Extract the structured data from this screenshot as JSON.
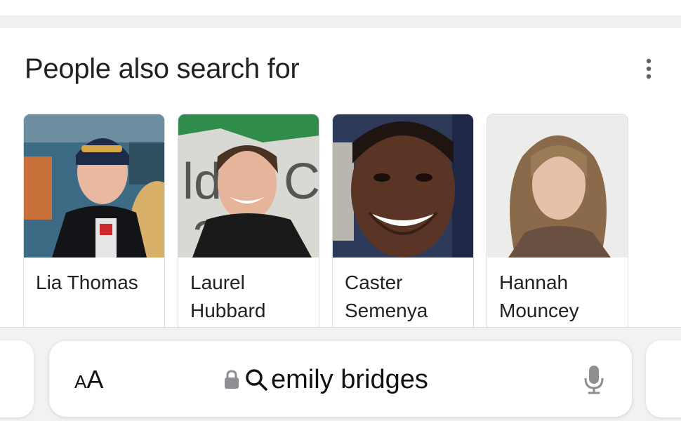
{
  "section": {
    "title": "People also search for",
    "more_icon": "vertical-dots-icon"
  },
  "people": [
    {
      "name": "Lia Thomas",
      "photo": "swimmer-portrait"
    },
    {
      "name": "Laurel Hubbard",
      "photo": "weightlifter-portrait"
    },
    {
      "name": "Caster Semenya",
      "photo": "runner-portrait"
    },
    {
      "name": "Hannah Mouncey",
      "photo": "athlete-portrait"
    }
  ],
  "address_bar": {
    "text_size_label_small": "A",
    "text_size_label_large": "A",
    "query": "emily bridges",
    "lock_icon": "lock-icon",
    "search_icon": "search-icon",
    "mic_icon": "microphone-icon"
  },
  "colors": {
    "text_primary": "#202124",
    "separator": "#eff1f3",
    "card_border": "#dadce0",
    "toolbar_bg": "#f2f2f4",
    "icon_gray": "#8e8e93"
  }
}
